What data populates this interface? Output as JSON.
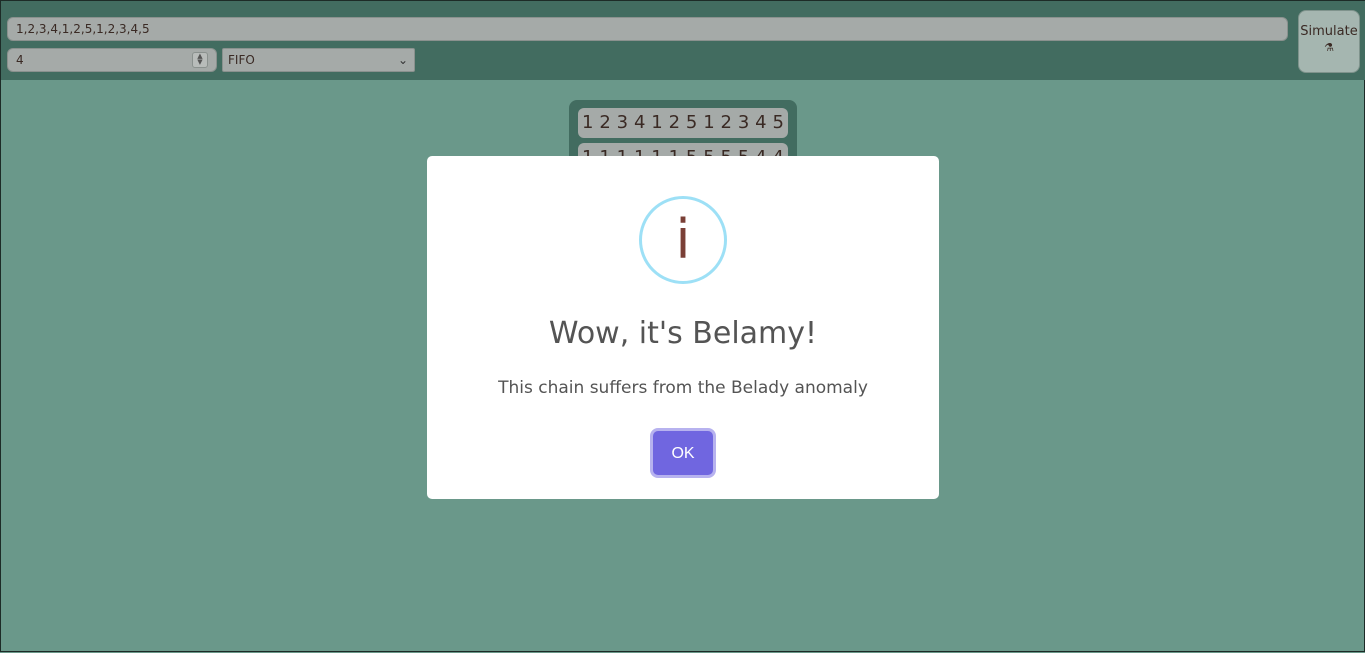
{
  "toolbar": {
    "chain_value": "1,2,3,4,1,2,5,1,2,3,4,5",
    "frames_value": "4",
    "algorithm_value": "FIFO",
    "simulate_label": "Simulate",
    "simulate_icon": "flask-icon"
  },
  "grid": {
    "reference_row": [
      "1",
      "2",
      "3",
      "4",
      "1",
      "2",
      "5",
      "1",
      "2",
      "3",
      "4",
      "5"
    ],
    "frame_row_partial": [
      "1",
      "1",
      "1",
      "1",
      "1",
      "1",
      "5",
      "5",
      "5",
      "5",
      "4",
      "4"
    ]
  },
  "modal": {
    "icon": "info-icon",
    "icon_glyph": "i",
    "title": "Wow, it's Belamy!",
    "text": "This chain suffers from the Belady anomaly",
    "ok_label": "OK",
    "accent_color": "#7066e0",
    "icon_color": "#9de0f6"
  }
}
